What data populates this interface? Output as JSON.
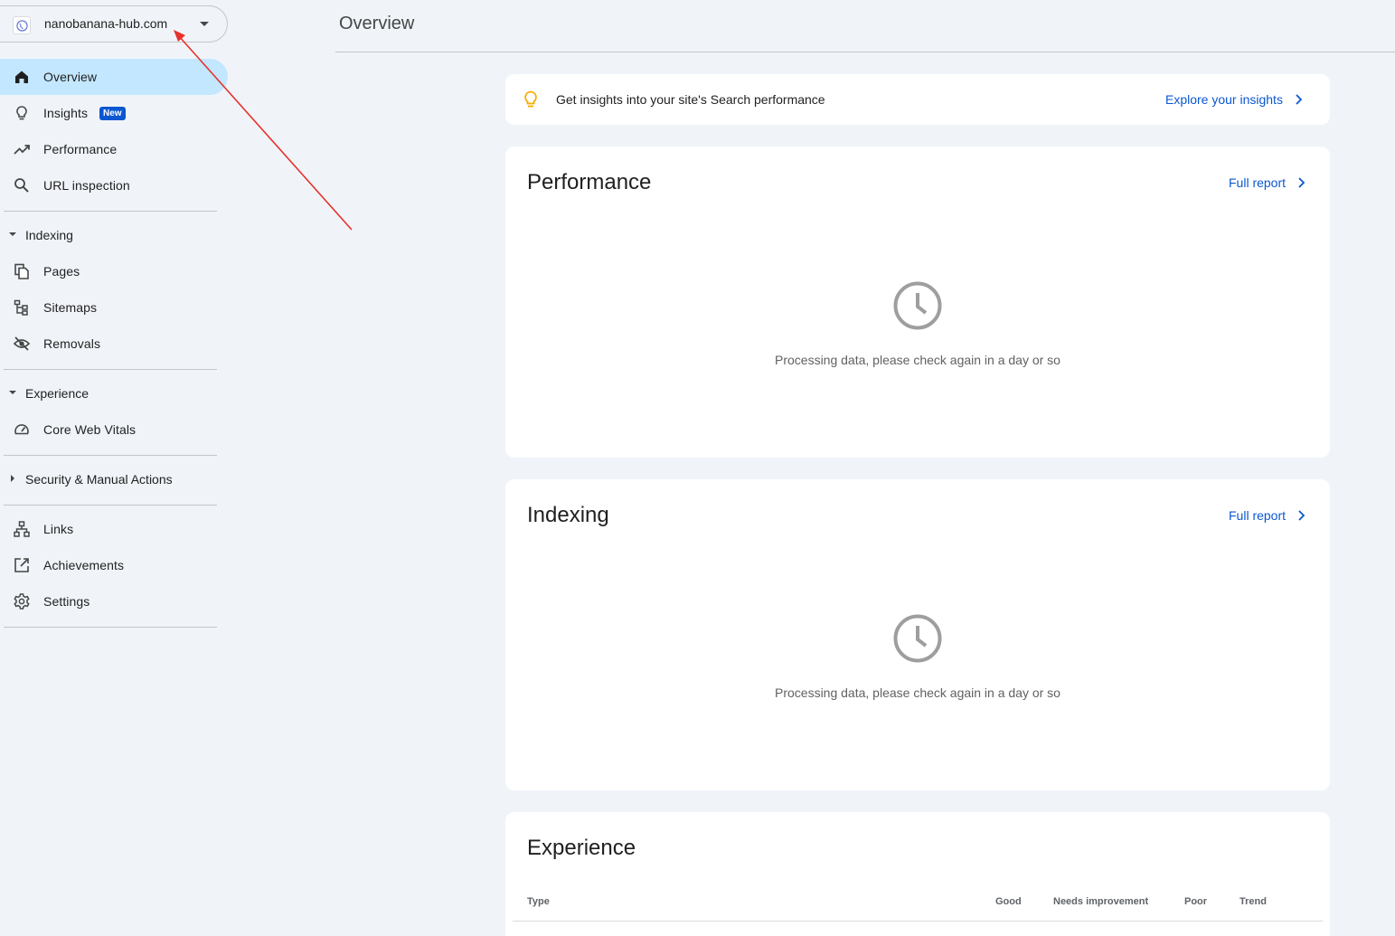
{
  "property": {
    "name": "nanobanana-hub.com",
    "icon": "globe-icon"
  },
  "nav": {
    "overview": "Overview",
    "insights": "Insights",
    "insights_badge": "New",
    "performance": "Performance",
    "url_inspection": "URL inspection",
    "indexing_section": "Indexing",
    "pages": "Pages",
    "sitemaps": "Sitemaps",
    "removals": "Removals",
    "experience_section": "Experience",
    "core_web_vitals": "Core Web Vitals",
    "security_section": "Security & Manual Actions",
    "links": "Links",
    "achievements": "Achievements",
    "settings": "Settings"
  },
  "header": {
    "title": "Overview"
  },
  "insights_banner": {
    "text": "Get insights into your site's Search performance",
    "link": "Explore your insights"
  },
  "performance_card": {
    "title": "Performance",
    "link": "Full report",
    "message": "Processing data, please check again in a day or so"
  },
  "indexing_card": {
    "title": "Indexing",
    "link": "Full report",
    "message": "Processing data, please check again in a day or so"
  },
  "experience_card": {
    "title": "Experience",
    "columns": [
      "Type",
      "Good",
      "Needs improvement",
      "Poor",
      "Trend"
    ]
  },
  "colors": {
    "background": "#f0f4f9",
    "active_nav": "#c2e7ff",
    "link": "#0b57d0",
    "badge": "#0b57d0",
    "bulb": "#f9ab00",
    "annotation_arrow": "#e8312a"
  }
}
